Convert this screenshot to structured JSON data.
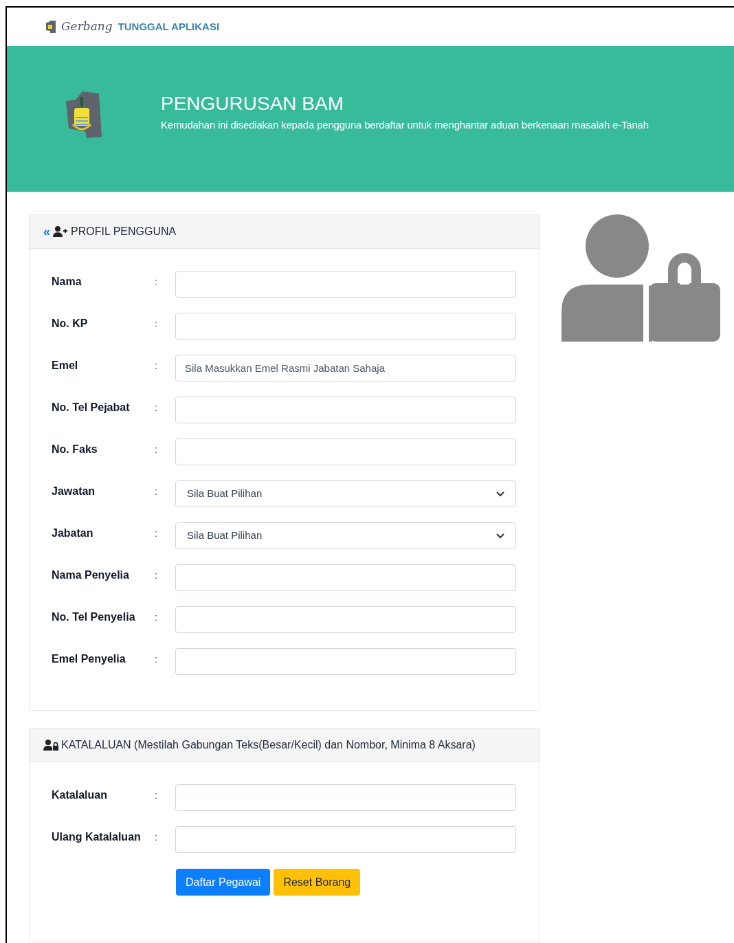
{
  "brand": {
    "script": "Gerbang",
    "title": "TUNGGAL APLIKASI"
  },
  "banner": {
    "title": "PENGURUSAN BAM",
    "subtitle": "Kemudahan ini disediakan kepada pengguna berdaftar untuk menghantar aduan berkenaan masalah e-Tanah"
  },
  "profile_card": {
    "back": "«",
    "title": "PROFIL PENGGUNA",
    "fields": [
      {
        "label": "Nama",
        "kind": "text"
      },
      {
        "label": "No. KP",
        "kind": "text"
      },
      {
        "label": "Emel",
        "kind": "text",
        "placeholder": "Sila Masukkan Emel Rasmi Jabatan Sahaja"
      },
      {
        "label": "No. Tel Pejabat",
        "kind": "text"
      },
      {
        "label": "No. Faks",
        "kind": "text"
      },
      {
        "label": "Jawatan",
        "kind": "select",
        "value": "Sila Buat Pilihan"
      },
      {
        "label": "Jabatan",
        "kind": "select",
        "value": "Sila Buat Pilihan"
      },
      {
        "label": "Nama Penyelia",
        "kind": "text"
      },
      {
        "label": "No. Tel Penyelia",
        "kind": "text"
      },
      {
        "label": "Emel Penyelia",
        "kind": "text"
      }
    ]
  },
  "password_card": {
    "title": "KATALALUAN (Mestilah Gabungan Teks(Besar/Kecil) dan Nombor, Minima 8 Aksara)",
    "fields": [
      {
        "label": "Katalaluan",
        "kind": "password"
      },
      {
        "label": "Ulang Katalaluan",
        "kind": "password"
      }
    ],
    "buttons": [
      {
        "label": "Daftar Pegawai",
        "kind": "primary"
      },
      {
        "label": "Reset Borang",
        "kind": "warning"
      }
    ]
  },
  "colon": ":"
}
